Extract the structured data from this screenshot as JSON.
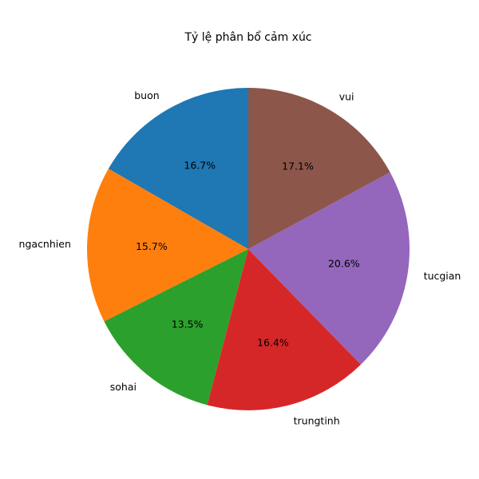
{
  "chart_data": {
    "type": "pie",
    "title": "Tỷ lệ phân bổ cảm xúc",
    "categories": [
      "buon",
      "ngacnhien",
      "sohai",
      "trungtinh",
      "tucgian",
      "vui"
    ],
    "values": [
      16.7,
      15.7,
      13.5,
      16.4,
      20.6,
      17.1
    ],
    "value_labels": [
      "16.7%",
      "15.7%",
      "13.5%",
      "16.4%",
      "20.6%",
      "17.1%"
    ],
    "colors": [
      "#1f77b4",
      "#ff7f0e",
      "#2ca02c",
      "#d62728",
      "#9467bd",
      "#8c564b"
    ],
    "start_angle_deg": 90,
    "direction": "counterclockwise",
    "legend": "none"
  }
}
